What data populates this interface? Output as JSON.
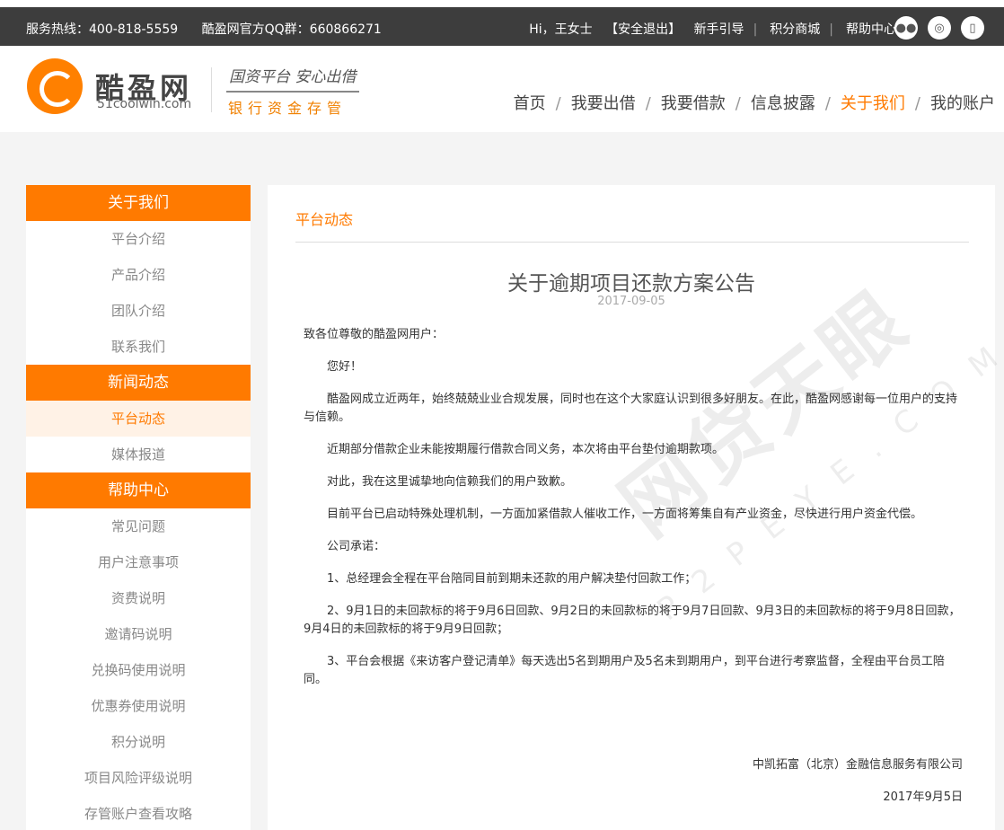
{
  "topbar": {
    "hotline": "服务热线：400-818-5559",
    "qq_group": "酷盈网官方QQ群：660866271",
    "greeting": "Hi，王女士",
    "logout": "【安全退出】",
    "links": [
      "新手引导",
      "积分商城",
      "帮助中心"
    ],
    "icons": [
      "wechat-icon",
      "weibo-icon",
      "mobile-icon"
    ]
  },
  "header": {
    "logo_name": "酷盈网",
    "logo_domain": "51coolwin.com",
    "slogan": "国资平台 安心出借",
    "tagline": "银行资金存管",
    "nav": [
      "首页",
      "我要出借",
      "我要借款",
      "信息披露",
      "关于我们",
      "我的账户"
    ],
    "active_nav": "关于我们"
  },
  "sidebar": {
    "sections": [
      {
        "heading": "关于我们",
        "items": [
          "平台介绍",
          "产品介绍",
          "团队介绍",
          "联系我们"
        ]
      },
      {
        "heading": "新闻动态",
        "items": [
          "平台动态",
          "媒体报道"
        ]
      },
      {
        "heading": "帮助中心",
        "items": [
          "常见问题",
          "用户注意事项",
          "资费说明",
          "邀请码说明",
          "兑换码使用说明",
          "优惠券使用说明",
          "积分说明",
          "项目风险评级说明",
          "存管账户查看攻略"
        ]
      }
    ],
    "active_item": "平台动态"
  },
  "content": {
    "section_title": "平台动态",
    "title": "关于逾期项目还款方案公告",
    "date": "2017-09-05",
    "salutation": "致各位尊敬的酷盈网用户：",
    "paragraphs": [
      "您好！",
      "酷盈网成立近两年，始终兢兢业业合规发展，同时也在这个大家庭认识到很多好朋友。在此，酷盈网感谢每一位用户的支持与信赖。",
      "近期部分借款企业未能按期履行借款合同义务，本次将由平台垫付逾期款项。",
      "对此，我在这里诚挚地向信赖我们的用户致歉。",
      "目前平台已启动特殊处理机制，一方面加紧借款人催收工作，一方面将筹集自有产业资金，尽快进行用户资金代偿。",
      "公司承诺：",
      "1、总经理会全程在平台陪同目前到期未还款的用户解决垫付回款工作；",
      "2、9月1日的未回款标的将于9月6日回款、9月2日的未回款标的将于9月7日回款、9月3日的未回款标的将于9月8日回款，9月4日的未回款标的将于9月9日回款；",
      "3、平台会根据《来访客户登记清单》每天选出5名到期用户及5名未到期用户，到平台进行考察监督，全程由平台员工陪同。"
    ],
    "signature": "中凯拓富（北京）金融信息服务有限公司",
    "sign_date": "2017年9月5日"
  },
  "watermark": {
    "main": "网贷天眼",
    "sub": "P2PEYE.COM"
  }
}
